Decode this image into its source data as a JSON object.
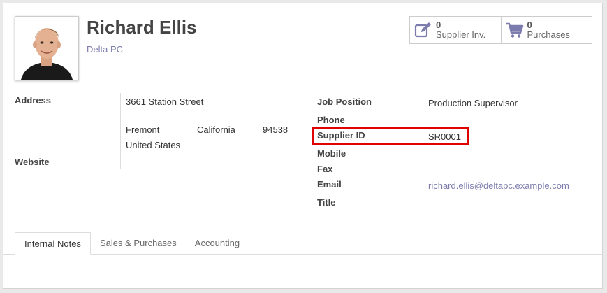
{
  "partner": {
    "name": "Richard Ellis",
    "company": "Delta PC"
  },
  "stats": [
    {
      "count": "0",
      "label": "Supplier Inv.",
      "icon": "pencil-square-icon"
    },
    {
      "count": "0",
      "label": "Purchases",
      "icon": "shopping-cart-icon"
    }
  ],
  "left_fields": {
    "address_label": "Address",
    "street": "3661 Station Street",
    "city": "Fremont",
    "state": "California",
    "zip": "94538",
    "country": "United States",
    "website_label": "Website"
  },
  "right_fields": {
    "job_position_label": "Job Position",
    "job_position_value": "Production Supervisor",
    "phone_label": "Phone",
    "supplier_id_label": "Supplier ID",
    "supplier_id_value": "SR0001",
    "mobile_label": "Mobile",
    "fax_label": "Fax",
    "email_label": "Email",
    "email_value": "richard.ellis@deltapc.example.com",
    "title_label": "Title"
  },
  "tabs": [
    "Internal Notes",
    "Sales & Purchases",
    "Accounting"
  ],
  "colors": {
    "accent": "#7c7bad",
    "highlight": "#e00000",
    "icon": "#7c7bad"
  }
}
